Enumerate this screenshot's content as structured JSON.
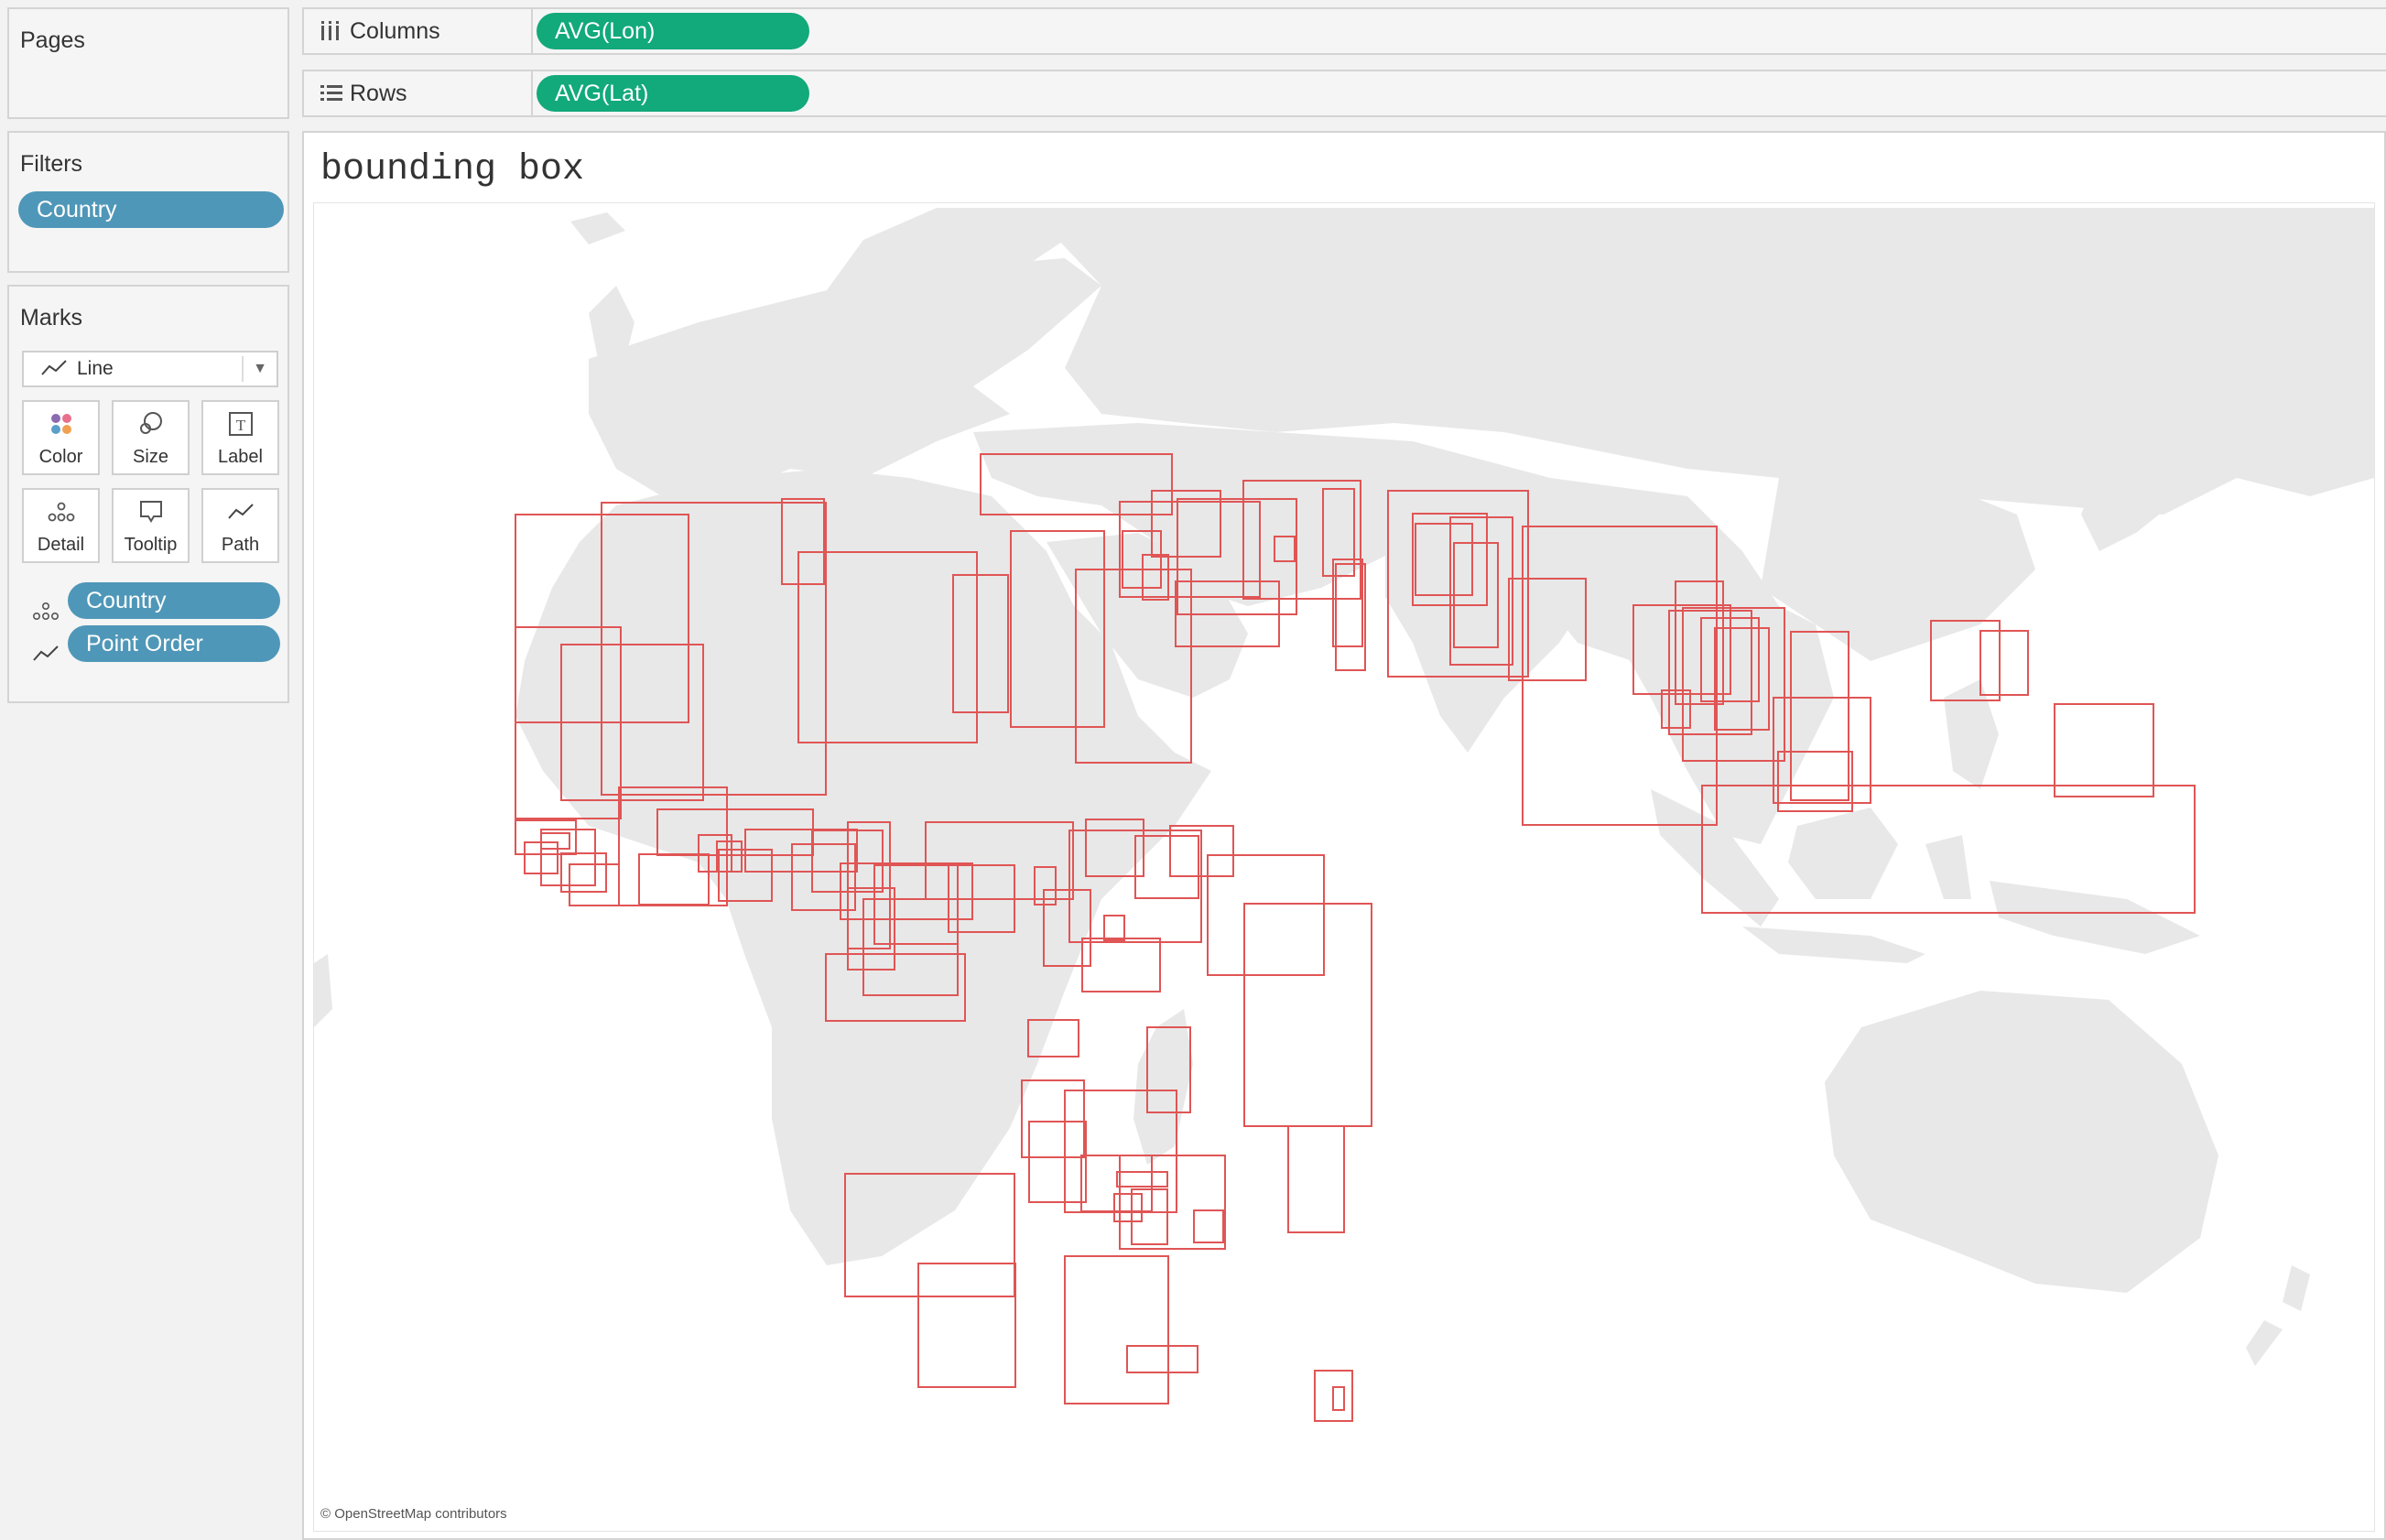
{
  "pages": {
    "title": "Pages"
  },
  "shelves": {
    "columns": {
      "label": "Columns",
      "pill": "AVG(Lon)",
      "icon": "columns-icon"
    },
    "rows": {
      "label": "Rows",
      "pill": "AVG(Lat)",
      "icon": "rows-icon"
    }
  },
  "filters": {
    "title": "Filters",
    "items": [
      "Country"
    ]
  },
  "marks": {
    "title": "Marks",
    "mark_type": "Line",
    "buttons": [
      {
        "label": "Color",
        "icon": "color-icon"
      },
      {
        "label": "Size",
        "icon": "size-icon"
      },
      {
        "label": "Label",
        "icon": "label-icon"
      },
      {
        "label": "Detail",
        "icon": "detail-icon"
      },
      {
        "label": "Tooltip",
        "icon": "tooltip-icon"
      },
      {
        "label": "Path",
        "icon": "path-icon"
      }
    ],
    "fields": [
      {
        "label": "Country",
        "icon": "detail-icon"
      },
      {
        "label": "Point Order",
        "icon": "path-icon"
      }
    ]
  },
  "view": {
    "title": "bounding box",
    "attribution": "© OpenStreetMap contributors",
    "box_color": "#e05555",
    "land_color": "#e8e8e8"
  },
  "colors": {
    "pill_blue": "#4f97b8",
    "pill_green": "#12a97b",
    "panel_bg": "#f5f5f5"
  }
}
